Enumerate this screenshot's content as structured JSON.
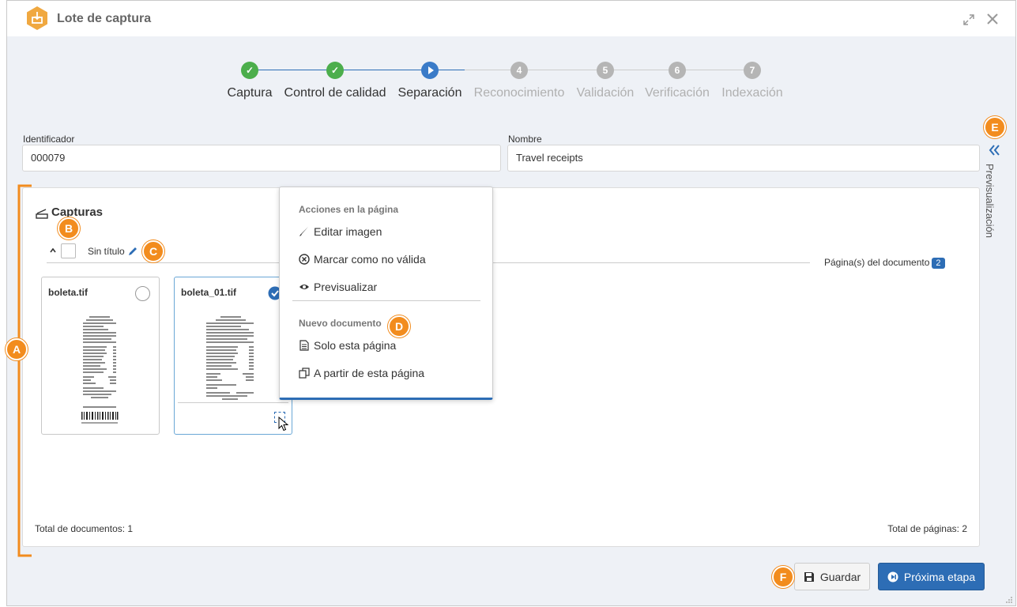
{
  "window": {
    "title": "Lote de captura"
  },
  "stepper": {
    "steps": [
      {
        "label": "Captura",
        "number": "",
        "state": "done"
      },
      {
        "label": "Control de calidad",
        "number": "",
        "state": "done"
      },
      {
        "label": "Separación",
        "number": "",
        "state": "current"
      },
      {
        "label": "Reconocimiento",
        "number": "4",
        "state": "pending"
      },
      {
        "label": "Validación",
        "number": "5",
        "state": "pending"
      },
      {
        "label": "Verificación",
        "number": "6",
        "state": "pending"
      },
      {
        "label": "Indexación",
        "number": "7",
        "state": "pending"
      }
    ]
  },
  "form": {
    "identifier_label": "Identificador",
    "identifier_value": "000079",
    "name_label": "Nombre",
    "name_value": "Travel receipts"
  },
  "captures": {
    "title": "Capturas",
    "document_title": "Sin título",
    "pages_label": "Página(s) del documento",
    "pages_count": "2",
    "cards": [
      {
        "name": "boleta.tif",
        "selected": false
      },
      {
        "name": "boleta_01.tif",
        "selected": true
      }
    ],
    "total_documents": "Total de documentos: 1",
    "total_pages": "Total de páginas: 2"
  },
  "context_menu": {
    "section1": "Acciones en la página",
    "edit": "Editar imagen",
    "invalid": "Marcar como no válida",
    "preview": "Previsualizar",
    "section2": "Nuevo documento",
    "only_page": "Solo esta página",
    "from_page": "A partir de esta página"
  },
  "preview_sidebar": {
    "label": "Previsualización"
  },
  "footer": {
    "save": "Guardar",
    "next": "Próxima etapa"
  },
  "callouts": {
    "a": "A",
    "b": "B",
    "c": "C",
    "d": "D",
    "e": "E",
    "f": "F"
  },
  "colors": {
    "accent": "#2d6db5",
    "done": "#4cae4c",
    "current": "#3a7bc8",
    "pending": "#b5b5b5",
    "callout": "#f28c1e"
  }
}
